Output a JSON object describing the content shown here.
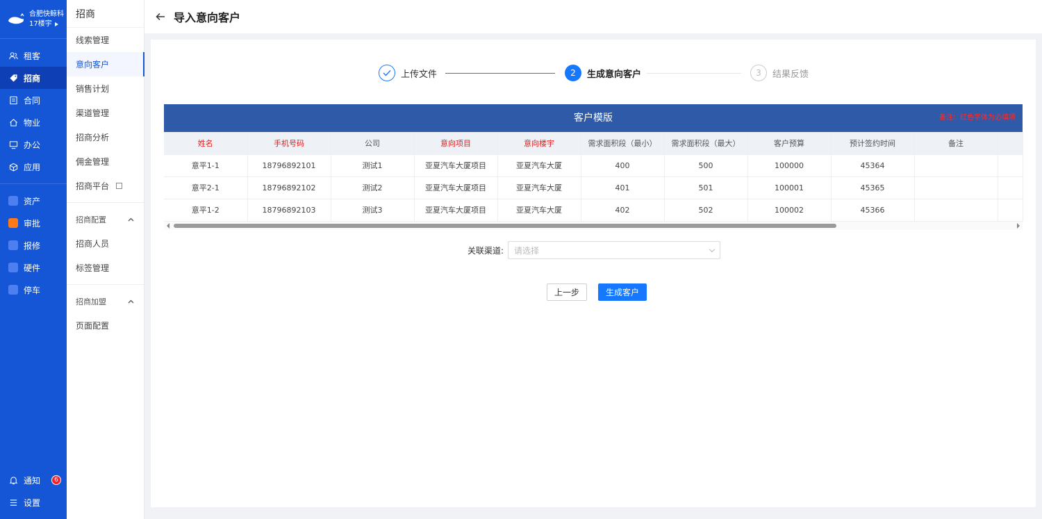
{
  "brand": {
    "org": "合肥快鲸科",
    "building": "17楼宇"
  },
  "nav": {
    "items": [
      {
        "label": "租客",
        "icon": "users-icon"
      },
      {
        "label": "招商",
        "icon": "tag-icon",
        "active": true
      },
      {
        "label": "合同",
        "icon": "document-icon"
      },
      {
        "label": "物业",
        "icon": "home-icon"
      },
      {
        "label": "办公",
        "icon": "monitor-icon"
      },
      {
        "label": "应用",
        "icon": "cube-icon"
      }
    ],
    "apps": [
      {
        "label": "资产",
        "icon": "asset-icon"
      },
      {
        "label": "审批",
        "icon": "approval-icon"
      },
      {
        "label": "报修",
        "icon": "repair-icon"
      },
      {
        "label": "硬件",
        "icon": "hardware-icon"
      },
      {
        "label": "停车",
        "icon": "parking-icon"
      }
    ],
    "notify_label": "通知",
    "notify_count": "6",
    "settings_label": "设置"
  },
  "subnav": {
    "title": "招商",
    "items": [
      "线索管理",
      "意向客户",
      "销售计划",
      "渠道管理",
      "招商分析",
      "佣金管理",
      "招商平台"
    ],
    "section1": {
      "label": "招商配置",
      "items": [
        "招商人员",
        "标签管理"
      ]
    },
    "section2": {
      "label": "招商加盟",
      "items": [
        "页面配置"
      ]
    }
  },
  "header": {
    "title": "导入意向客户"
  },
  "steps": [
    {
      "num": "",
      "label": "上传文件",
      "state": "done"
    },
    {
      "num": "2",
      "label": "生成意向客户",
      "state": "current"
    },
    {
      "num": "3",
      "label": "结果反馈",
      "state": "wait"
    }
  ],
  "table": {
    "banner": "客户模版",
    "note": "备注：红色字体为必填项",
    "columns": [
      {
        "label": "姓名",
        "required": true
      },
      {
        "label": "手机号码",
        "required": true
      },
      {
        "label": "公司",
        "required": false
      },
      {
        "label": "意向项目",
        "required": true
      },
      {
        "label": "意向楼宇",
        "required": true
      },
      {
        "label": "需求面积段（最小）",
        "required": false
      },
      {
        "label": "需求面积段（最大）",
        "required": false
      },
      {
        "label": "客户预算",
        "required": false
      },
      {
        "label": "预计签约时间",
        "required": false
      },
      {
        "label": "备注",
        "required": false
      },
      {
        "label": "",
        "required": false
      }
    ],
    "rows": [
      [
        "意平1-1",
        "18796892101",
        "测试1",
        "亚夏汽车大厦项目",
        "亚夏汽车大厦",
        "400",
        "500",
        "100000",
        "45364",
        "",
        ""
      ],
      [
        "意平2-1",
        "18796892102",
        "测试2",
        "亚夏汽车大厦项目",
        "亚夏汽车大厦",
        "401",
        "501",
        "100001",
        "45365",
        "",
        ""
      ],
      [
        "意平1-2",
        "18796892103",
        "测试3",
        "亚夏汽车大厦项目",
        "亚夏汽车大厦",
        "402",
        "502",
        "100002",
        "45366",
        "",
        ""
      ]
    ]
  },
  "form": {
    "channel_label": "关联渠道:",
    "channel_placeholder": "请选择"
  },
  "buttons": {
    "prev": "上一步",
    "generate": "生成客户"
  },
  "colors": {
    "nav_bg": "#1456d6",
    "primary": "#1677ff",
    "banner": "#2e5aa8",
    "required": "#e02020"
  }
}
